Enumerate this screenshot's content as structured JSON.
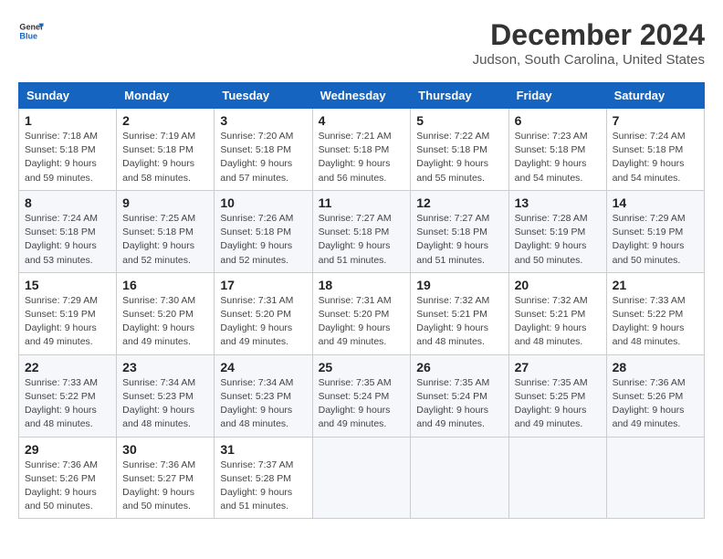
{
  "logo": {
    "general": "General",
    "blue": "Blue"
  },
  "header": {
    "month": "December 2024",
    "location": "Judson, South Carolina, United States"
  },
  "weekdays": [
    "Sunday",
    "Monday",
    "Tuesday",
    "Wednesday",
    "Thursday",
    "Friday",
    "Saturday"
  ],
  "weeks": [
    [
      {
        "day": "1",
        "sunrise": "7:18 AM",
        "sunset": "5:18 PM",
        "daylight": "9 hours and 59 minutes."
      },
      {
        "day": "2",
        "sunrise": "7:19 AM",
        "sunset": "5:18 PM",
        "daylight": "9 hours and 58 minutes."
      },
      {
        "day": "3",
        "sunrise": "7:20 AM",
        "sunset": "5:18 PM",
        "daylight": "9 hours and 57 minutes."
      },
      {
        "day": "4",
        "sunrise": "7:21 AM",
        "sunset": "5:18 PM",
        "daylight": "9 hours and 56 minutes."
      },
      {
        "day": "5",
        "sunrise": "7:22 AM",
        "sunset": "5:18 PM",
        "daylight": "9 hours and 55 minutes."
      },
      {
        "day": "6",
        "sunrise": "7:23 AM",
        "sunset": "5:18 PM",
        "daylight": "9 hours and 54 minutes."
      },
      {
        "day": "7",
        "sunrise": "7:24 AM",
        "sunset": "5:18 PM",
        "daylight": "9 hours and 54 minutes."
      }
    ],
    [
      {
        "day": "8",
        "sunrise": "7:24 AM",
        "sunset": "5:18 PM",
        "daylight": "9 hours and 53 minutes."
      },
      {
        "day": "9",
        "sunrise": "7:25 AM",
        "sunset": "5:18 PM",
        "daylight": "9 hours and 52 minutes."
      },
      {
        "day": "10",
        "sunrise": "7:26 AM",
        "sunset": "5:18 PM",
        "daylight": "9 hours and 52 minutes."
      },
      {
        "day": "11",
        "sunrise": "7:27 AM",
        "sunset": "5:18 PM",
        "daylight": "9 hours and 51 minutes."
      },
      {
        "day": "12",
        "sunrise": "7:27 AM",
        "sunset": "5:18 PM",
        "daylight": "9 hours and 51 minutes."
      },
      {
        "day": "13",
        "sunrise": "7:28 AM",
        "sunset": "5:19 PM",
        "daylight": "9 hours and 50 minutes."
      },
      {
        "day": "14",
        "sunrise": "7:29 AM",
        "sunset": "5:19 PM",
        "daylight": "9 hours and 50 minutes."
      }
    ],
    [
      {
        "day": "15",
        "sunrise": "7:29 AM",
        "sunset": "5:19 PM",
        "daylight": "9 hours and 49 minutes."
      },
      {
        "day": "16",
        "sunrise": "7:30 AM",
        "sunset": "5:20 PM",
        "daylight": "9 hours and 49 minutes."
      },
      {
        "day": "17",
        "sunrise": "7:31 AM",
        "sunset": "5:20 PM",
        "daylight": "9 hours and 49 minutes."
      },
      {
        "day": "18",
        "sunrise": "7:31 AM",
        "sunset": "5:20 PM",
        "daylight": "9 hours and 49 minutes."
      },
      {
        "day": "19",
        "sunrise": "7:32 AM",
        "sunset": "5:21 PM",
        "daylight": "9 hours and 48 minutes."
      },
      {
        "day": "20",
        "sunrise": "7:32 AM",
        "sunset": "5:21 PM",
        "daylight": "9 hours and 48 minutes."
      },
      {
        "day": "21",
        "sunrise": "7:33 AM",
        "sunset": "5:22 PM",
        "daylight": "9 hours and 48 minutes."
      }
    ],
    [
      {
        "day": "22",
        "sunrise": "7:33 AM",
        "sunset": "5:22 PM",
        "daylight": "9 hours and 48 minutes."
      },
      {
        "day": "23",
        "sunrise": "7:34 AM",
        "sunset": "5:23 PM",
        "daylight": "9 hours and 48 minutes."
      },
      {
        "day": "24",
        "sunrise": "7:34 AM",
        "sunset": "5:23 PM",
        "daylight": "9 hours and 48 minutes."
      },
      {
        "day": "25",
        "sunrise": "7:35 AM",
        "sunset": "5:24 PM",
        "daylight": "9 hours and 49 minutes."
      },
      {
        "day": "26",
        "sunrise": "7:35 AM",
        "sunset": "5:24 PM",
        "daylight": "9 hours and 49 minutes."
      },
      {
        "day": "27",
        "sunrise": "7:35 AM",
        "sunset": "5:25 PM",
        "daylight": "9 hours and 49 minutes."
      },
      {
        "day": "28",
        "sunrise": "7:36 AM",
        "sunset": "5:26 PM",
        "daylight": "9 hours and 49 minutes."
      }
    ],
    [
      {
        "day": "29",
        "sunrise": "7:36 AM",
        "sunset": "5:26 PM",
        "daylight": "9 hours and 50 minutes."
      },
      {
        "day": "30",
        "sunrise": "7:36 AM",
        "sunset": "5:27 PM",
        "daylight": "9 hours and 50 minutes."
      },
      {
        "day": "31",
        "sunrise": "7:37 AM",
        "sunset": "5:28 PM",
        "daylight": "9 hours and 51 minutes."
      },
      null,
      null,
      null,
      null
    ]
  ]
}
